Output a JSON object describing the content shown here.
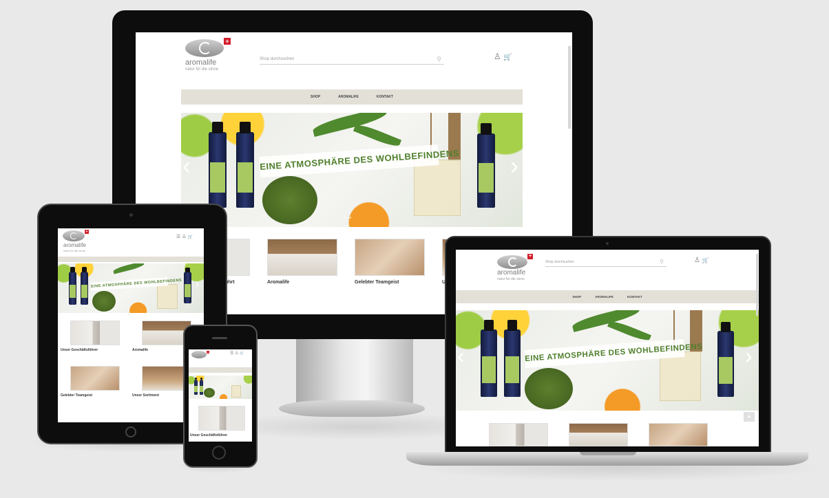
{
  "site": {
    "brand_name": "aromalife",
    "tagline": "natur für die sinne",
    "flag": "+",
    "search_placeholder": "Shop durchsuchen",
    "nav": [
      "SHOP",
      "AROMALIFE",
      "KONTAKT"
    ],
    "hero_banner": "EINE ATMOSPHÄRE DES WOHLBEFINDENS",
    "tiles": [
      {
        "label": "Unser Geschäftsführer",
        "image": "person-photo"
      },
      {
        "label": "Aromalife",
        "image": "bottles-photo"
      },
      {
        "label": "Gelebter Teamgeist",
        "image": "hands-photo"
      },
      {
        "label": "Unser Sortiment",
        "image": "shelf-photo"
      }
    ],
    "desktop_tile_labels": [
      "ührt",
      "Aromalife",
      "Gelebter Teamgeist",
      "U"
    ],
    "tablet_tile_labels": [
      "Unser Geschäftsführer",
      "Aromalife",
      "Gelebter Teamgeist",
      "Unser Sortiment"
    ],
    "phone_tile_label": "Unser Geschäftsführer",
    "icons": {
      "user": "user-icon",
      "cart": "cart-icon",
      "search": "search-icon",
      "menu": "menu-icon",
      "prev": "chevron-left-icon",
      "next": "chevron-right-icon"
    },
    "glyphs": {
      "user": "♙",
      "cart": "🛒",
      "search": "⚲",
      "menu": "☰",
      "prev": "‹",
      "next": "›",
      "dots": "• • •",
      "scroll_up": "▲"
    }
  },
  "colors": {
    "accent": "#d21f2b",
    "nav_bg": "#e3e0d8",
    "banner_text": "#4f7f2c",
    "device": "#0d0d0d",
    "background": "#e9e9e9"
  }
}
